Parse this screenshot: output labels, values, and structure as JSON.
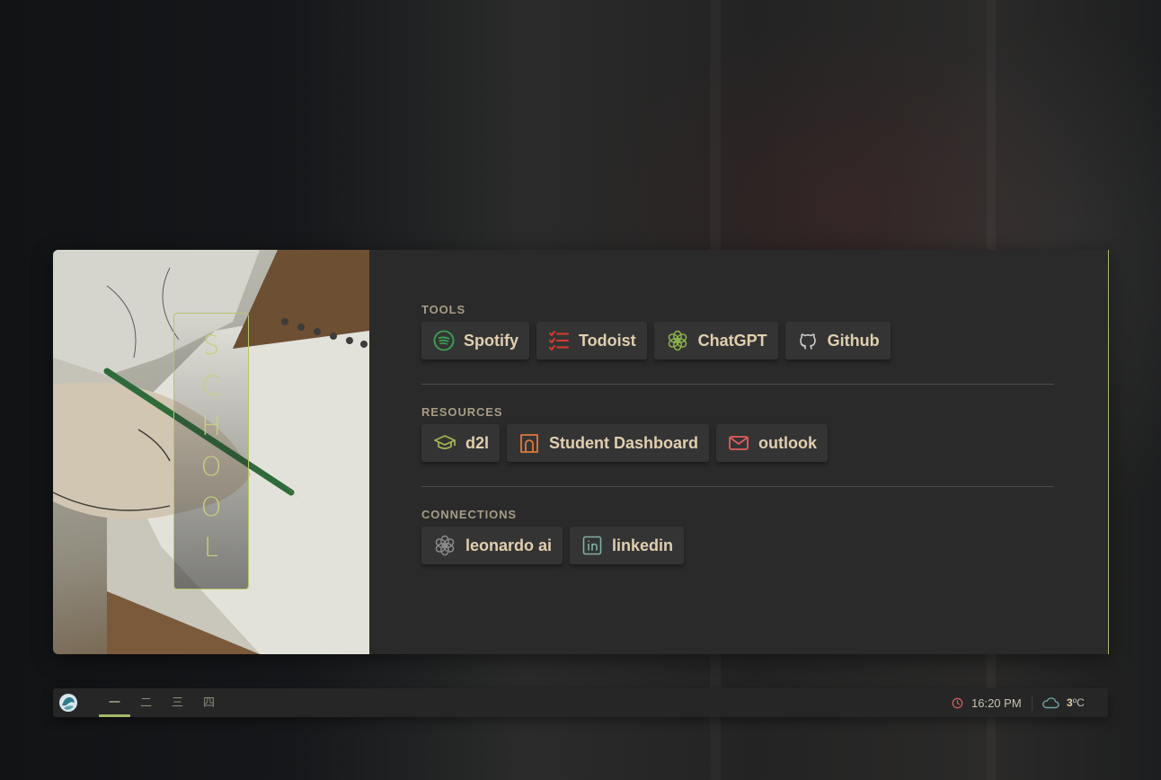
{
  "hero": {
    "title": "SCHOOL"
  },
  "sections": [
    {
      "title": "TOOLS",
      "links": [
        {
          "label": "Spotify",
          "icon": "spotify-icon",
          "color": "#3aa353"
        },
        {
          "label": "Todoist",
          "icon": "todoist-icon",
          "color": "#d63b2f"
        },
        {
          "label": "ChatGPT",
          "icon": "openai-icon",
          "color": "#8bb04a"
        },
        {
          "label": "Github",
          "icon": "github-icon",
          "color": "#cfcfcf"
        }
      ]
    },
    {
      "title": "RESOURCES",
      "links": [
        {
          "label": "d2l",
          "icon": "graduation-cap-icon",
          "color": "#a5b84e"
        },
        {
          "label": "Student Dashboard",
          "icon": "door-icon",
          "color": "#e07a3a"
        },
        {
          "label": "outlook",
          "icon": "mail-icon",
          "color": "#e35c5c"
        }
      ]
    },
    {
      "title": "CONNECTIONS",
      "links": [
        {
          "label": "leonardo ai",
          "icon": "openai-icon",
          "color": "#8a8a8a"
        },
        {
          "label": "linkedin",
          "icon": "linkedin-icon",
          "color": "#7fb0a6"
        }
      ]
    }
  ],
  "taskbar": {
    "workspaces": [
      "一",
      "二",
      "三",
      "四"
    ],
    "active_workspace": "一",
    "time": "16:20 PM",
    "temperature": "3",
    "unit": "ºC"
  },
  "colors": {
    "accent": "#a4b86a",
    "link_text": "#e0cfae",
    "card_bg": "#2a2a2a"
  }
}
